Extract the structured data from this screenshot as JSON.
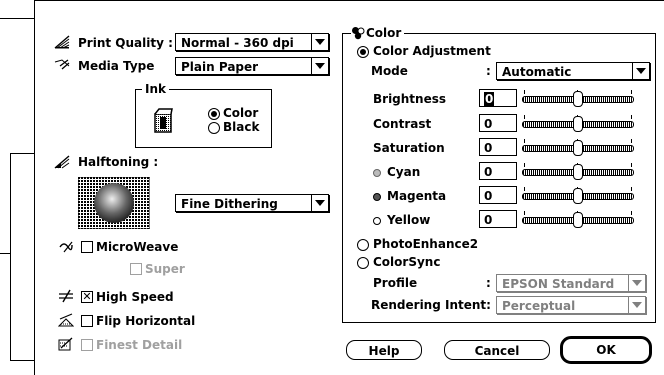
{
  "print_quality": {
    "label": "Print Quality :",
    "value": "Normal - 360 dpi"
  },
  "media_type": {
    "label": "Media Type",
    "value": "Plain Paper"
  },
  "ink": {
    "title": "Ink",
    "options": [
      "Color",
      "Black"
    ],
    "selected": "Color"
  },
  "halftoning": {
    "label": "Halftoning   :",
    "value": "Fine Dithering"
  },
  "checkboxes": {
    "microweave": {
      "label": "MicroWeave",
      "checked": false
    },
    "super": {
      "label": "Super",
      "checked": false,
      "enabled": false
    },
    "high_speed": {
      "label": "High Speed",
      "checked": true
    },
    "flip_horizontal": {
      "label": "Flip Horizontal",
      "checked": false
    },
    "finest_detail": {
      "label": "Finest Detail",
      "checked": false,
      "enabled": false
    }
  },
  "color_group": {
    "title": "Color",
    "color_adjustment": "Color Adjustment",
    "mode_label": "Mode",
    "mode_colon": ":",
    "mode_value": "Automatic",
    "sliders": [
      {
        "label": "Brightness",
        "value": "0"
      },
      {
        "label": "Contrast",
        "value": "0"
      },
      {
        "label": "Saturation",
        "value": "0"
      },
      {
        "label": "Cyan",
        "value": "0"
      },
      {
        "label": "Magenta",
        "value": "0"
      },
      {
        "label": "Yellow",
        "value": "0"
      }
    ],
    "photoenhance": "PhotoEnhance2",
    "colorsync": "ColorSync",
    "profile_label": "Profile",
    "profile_colon": ":",
    "profile_value": "EPSON Standard",
    "rendering_label": "Rendering Intent:",
    "rendering_value": "Perceptual"
  },
  "buttons": {
    "help": "Help",
    "cancel": "Cancel",
    "ok": "OK"
  },
  "icons": {
    "print_quality": "print-quality-icon",
    "media_type": "media-type-icon",
    "ink": "ink-cartridge-icon",
    "halftoning": "halftoning-icon",
    "microweave": "microweave-icon",
    "high_speed": "high-speed-icon",
    "flip_horizontal": "flip-horizontal-icon",
    "finest_detail": "finest-detail-icon"
  }
}
